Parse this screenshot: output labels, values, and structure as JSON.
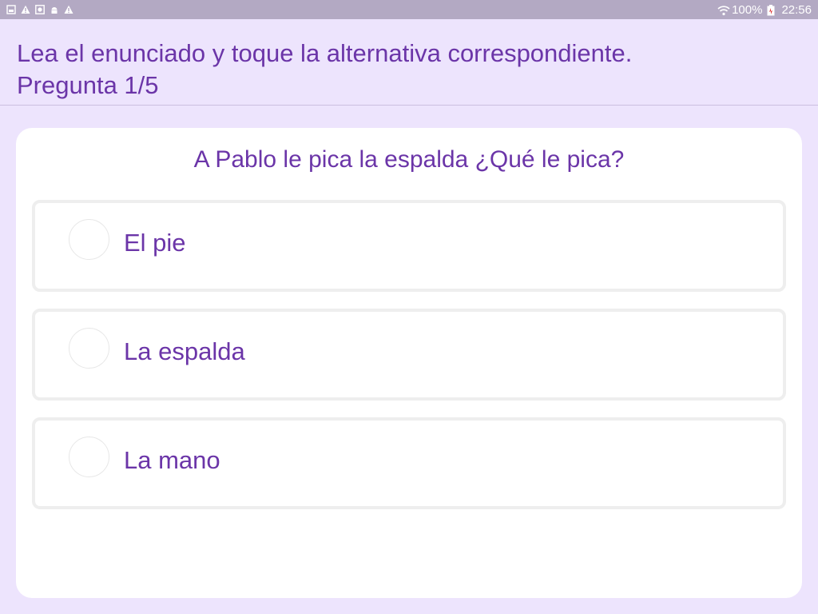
{
  "status_bar": {
    "left_icons": [
      "screenshot-icon",
      "warning-icon",
      "photo-icon",
      "android-icon",
      "warning-icon"
    ],
    "right_icons": [
      "wifi-icon",
      "battery-icon"
    ],
    "battery": "100%",
    "time": "22:56"
  },
  "header": {
    "instruction": "Lea el enunciado y toque la alternativa correspondiente.",
    "progress": "Pregunta 1/5"
  },
  "question": {
    "text": "A Pablo le pica la espalda ¿Qué le pica?"
  },
  "options": [
    {
      "label": "El pie"
    },
    {
      "label": "La espalda"
    },
    {
      "label": "La mano"
    }
  ],
  "colors": {
    "background": "#ede4fd",
    "status_bar": "#b3a9c3",
    "accent_text": "#6b35a8",
    "card": "#ffffff",
    "option_border": "#eeeeee"
  }
}
